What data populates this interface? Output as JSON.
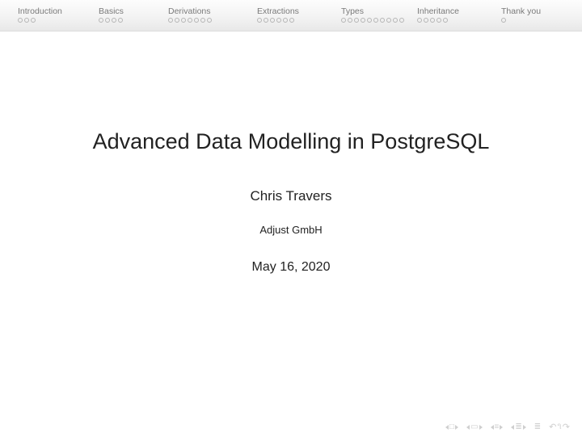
{
  "nav": {
    "sections": [
      {
        "label": "Introduction",
        "slides": 3
      },
      {
        "label": "Basics",
        "slides": 4
      },
      {
        "label": "Derivations",
        "slides": 7
      },
      {
        "label": "Extractions",
        "slides": 6
      },
      {
        "label": "Types",
        "slides": 10
      },
      {
        "label": "Inheritance",
        "slides": 5
      },
      {
        "label": "Thank you",
        "slides": 1
      }
    ]
  },
  "slide": {
    "title": "Advanced Data Modelling in PostgreSQL",
    "author": "Chris Travers",
    "affiliation": "Adjust GmbH",
    "date": "May 16, 2020"
  },
  "footer": {
    "icons": [
      "frame",
      "section",
      "subsection",
      "appendix",
      "mode",
      "loop"
    ]
  }
}
